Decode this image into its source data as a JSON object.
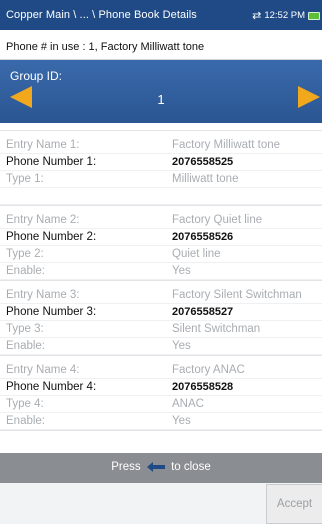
{
  "header": {
    "breadcrumb": "Copper Main \\ ... \\ Phone Book Details",
    "time": "12:52 PM",
    "swap_icon": "swap-arrows-icon",
    "battery_icon": "battery-icon"
  },
  "info": {
    "text": "Phone # in use : 1, Factory Milliwatt tone"
  },
  "group": {
    "label": "Group ID:",
    "value": "1",
    "accent_color": "#f2a81d"
  },
  "entries": [
    {
      "name_label": "Entry Name 1:",
      "name_value": "Factory Milliwatt tone",
      "phone_label": "Phone Number 1:",
      "phone_value": "2076558525",
      "type_label": "Type 1:",
      "type_value": "Milliwatt tone"
    },
    {
      "name_label": "Entry Name 2:",
      "name_value": "Factory Quiet line",
      "phone_label": "Phone Number 2:",
      "phone_value": "2076558526",
      "type_label": "Type 2:",
      "type_value": "Quiet line",
      "enable_label": "Enable:",
      "enable_value": "Yes"
    },
    {
      "name_label": "Entry Name 3:",
      "name_value": "Factory Silent Switchman",
      "phone_label": "Phone Number 3:",
      "phone_value": "2076558527",
      "type_label": "Type 3:",
      "type_value": "Silent Switchman",
      "enable_label": "Enable:",
      "enable_value": "Yes"
    },
    {
      "name_label": "Entry Name 4:",
      "name_value": "Factory ANAC",
      "phone_label": "Phone Number 4:",
      "phone_value": "2076558528",
      "type_label": "Type 4:",
      "type_value": "ANAC",
      "enable_label": "Enable:",
      "enable_value": "Yes"
    }
  ],
  "footer": {
    "press": "Press",
    "to_close": "to close",
    "back_icon": "back-arrow-icon"
  },
  "buttons": {
    "accept": "Accept"
  },
  "colors": {
    "titlebar": "#1f4a86",
    "group_bar": "#2f5c9a",
    "footer_bar": "#8a8d91"
  }
}
